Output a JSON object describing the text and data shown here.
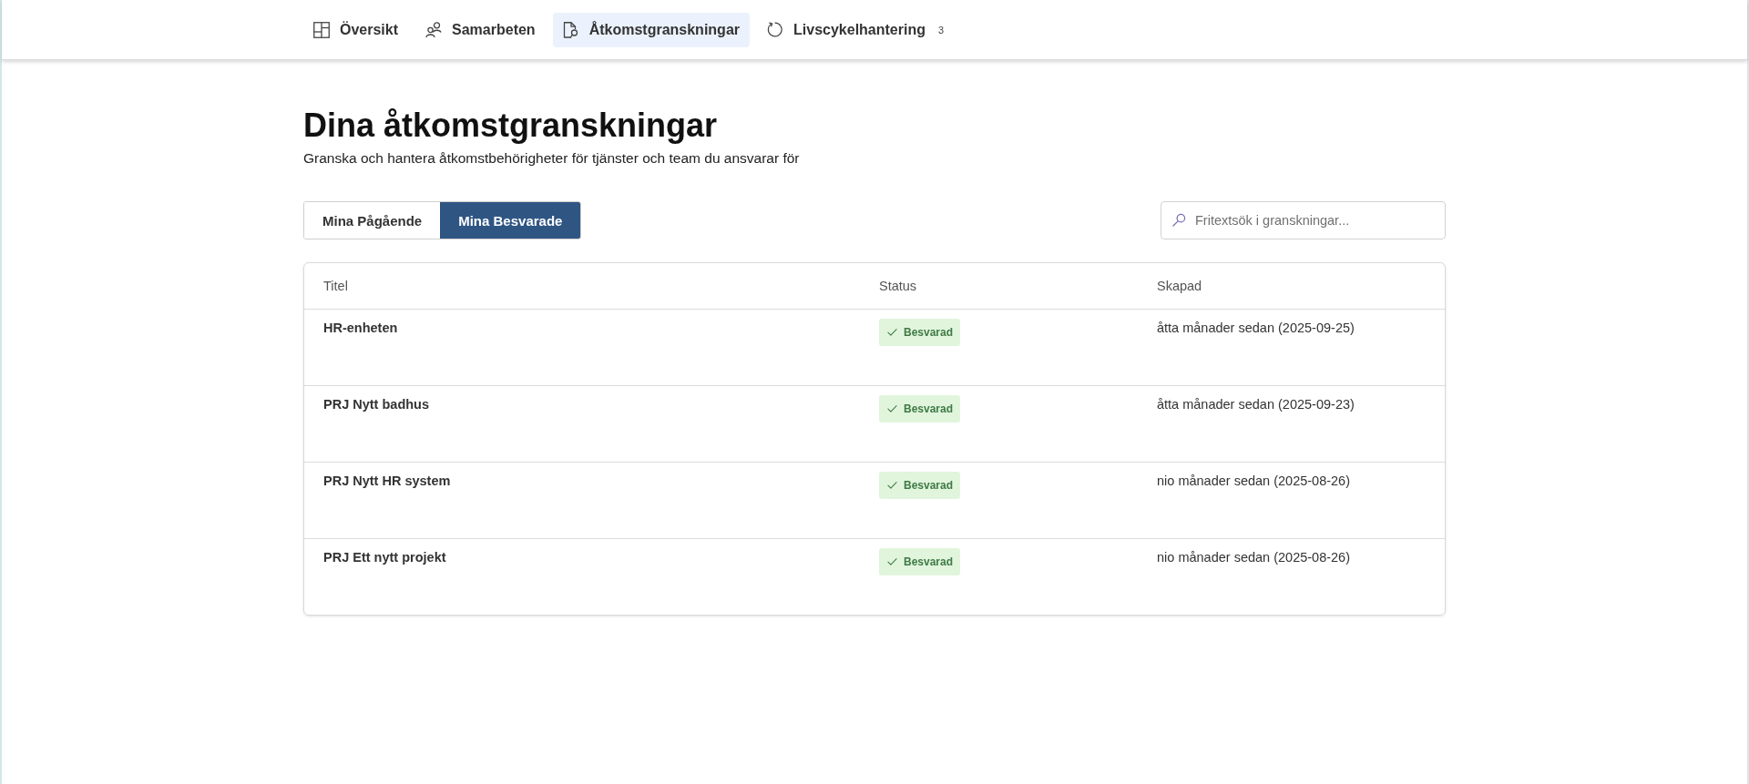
{
  "nav": {
    "items": [
      {
        "label": "Översikt",
        "selected": false
      },
      {
        "label": "Samarbeten",
        "selected": false
      },
      {
        "label": "Åtkomstgranskningar",
        "selected": true
      },
      {
        "label": "Livscykelhantering",
        "selected": false,
        "count": "3"
      }
    ]
  },
  "page": {
    "title": "Dina åtkomstgranskningar",
    "subtitle": "Granska och hantera åtkomstbehörigheter för tjänster och team du ansvarar för"
  },
  "filter_tabs": [
    {
      "label": "Mina Pågående",
      "selected": false
    },
    {
      "label": "Mina Besvarade",
      "selected": true
    }
  ],
  "search": {
    "placeholder": "Fritextsök i granskningar..."
  },
  "table": {
    "columns": [
      "Titel",
      "Status",
      "Skapad"
    ],
    "rows": [
      {
        "title": "HR-enheten",
        "status": "Besvarad",
        "created": "åtta månader sedan (2025-09-25)"
      },
      {
        "title": "PRJ Nytt badhus",
        "status": "Besvarad",
        "created": "åtta månader sedan (2025-09-23)"
      },
      {
        "title": "PRJ Nytt HR system",
        "status": "Besvarad",
        "created": "nio månader sedan (2025-08-26)"
      },
      {
        "title": "PRJ Ett nytt projekt",
        "status": "Besvarad",
        "created": "nio månader sedan (2025-08-26)"
      }
    ]
  }
}
